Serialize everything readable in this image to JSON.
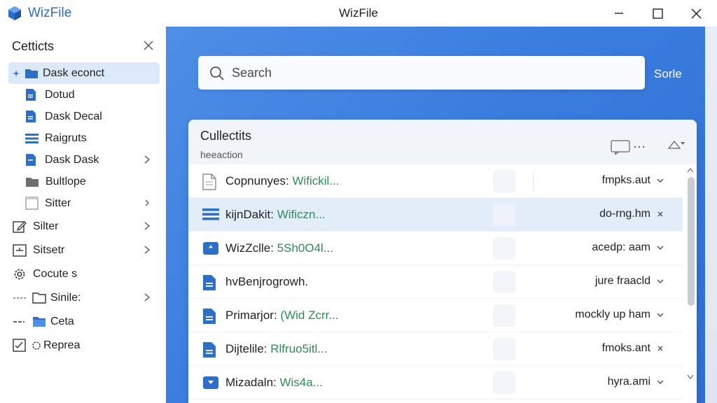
{
  "app": {
    "name": "WizFile",
    "window_title": "WizFile",
    "accent": "#2d6ec8"
  },
  "sidebar": {
    "title": "Cetticts",
    "items": [
      {
        "label": "Dask econct",
        "icon": "folder-icon",
        "active": true
      },
      {
        "label": "Dotud",
        "icon": "document-icon"
      },
      {
        "label": "Dask Decal",
        "icon": "document-icon"
      },
      {
        "label": "Raigruts",
        "icon": "list-icon"
      },
      {
        "label": "Dask Dask",
        "icon": "document-icon"
      },
      {
        "label": "Bultlope",
        "icon": "folder-icon"
      },
      {
        "label": "Sitter",
        "icon": "window-icon"
      },
      {
        "label": "Silter",
        "icon": "edit-icon"
      },
      {
        "label": "Sitsetr",
        "icon": "terminal-icon"
      },
      {
        "label": "Cocute s",
        "icon": "gear-icon"
      },
      {
        "label": "Sinile:",
        "icon": "folder-outline-icon"
      },
      {
        "label": "Ceta",
        "icon": "folder-blue-icon"
      },
      {
        "label": "Reprea",
        "icon": "checklist-icon"
      }
    ]
  },
  "search": {
    "placeholder": "Search",
    "sort_label": "Sorle"
  },
  "collection": {
    "title": "Cullectits",
    "subtitle": "heeaction",
    "rows": [
      {
        "name": "Copnunyes: ",
        "ext": "Wifickil...",
        "meta": "fmpks.aut",
        "action": "chevron",
        "icon": "document-outline-icon"
      },
      {
        "name": "kijnDakit: ",
        "ext": "Wificzn...",
        "meta": "do-rng.hm",
        "action": "close",
        "icon": "list-icon",
        "selected": true
      },
      {
        "name": "WizZclle: ",
        "ext": "5Sh0O4l...",
        "meta": "acedp: aam",
        "action": "chevron",
        "icon": "folder-blue-icon"
      },
      {
        "name": "hvBenjrogrowh.",
        "ext": "",
        "meta": "jure fraacld",
        "action": "chevron",
        "icon": "document-icon"
      },
      {
        "name": "Primarjor: ",
        "ext": "(Wid Zcrr...",
        "meta": "mockly up ham",
        "action": "chevron",
        "icon": "document-icon"
      },
      {
        "name": "Dijtelile: ",
        "ext": "Rlfruo5itl...",
        "meta": "fmoks.ant",
        "action": "close",
        "icon": "document-icon"
      },
      {
        "name": "Mizadaln: ",
        "ext": "Wis4a...",
        "meta": "hyra.ami",
        "action": "chevron",
        "icon": "folder-blue-icon"
      }
    ]
  }
}
